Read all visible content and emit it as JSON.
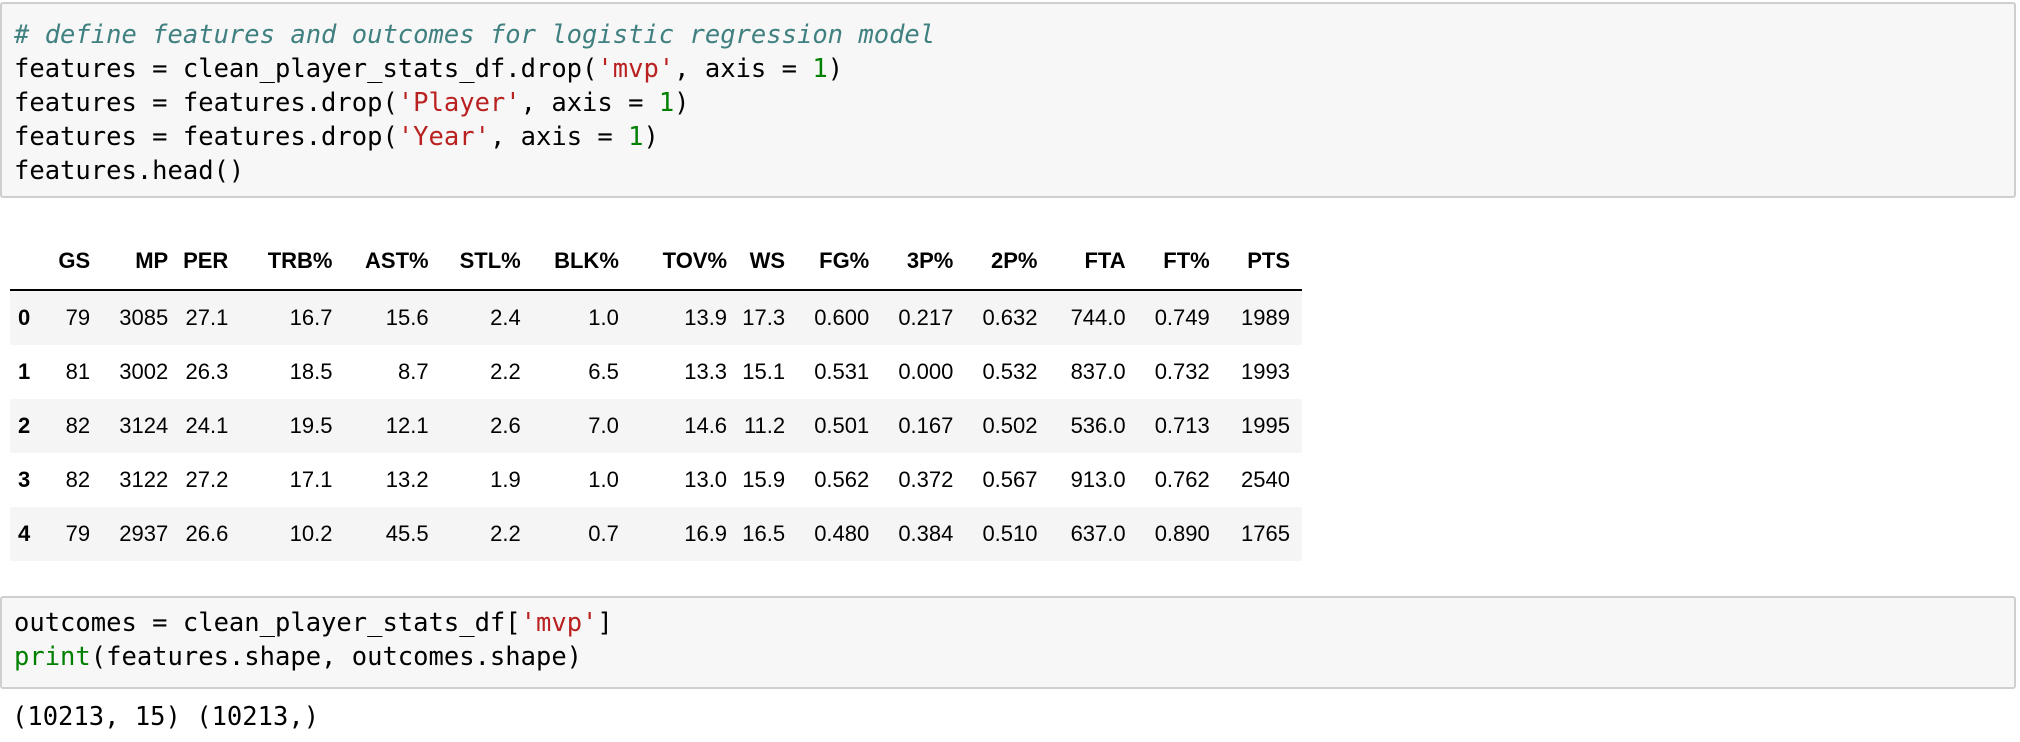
{
  "cell1": {
    "line1": {
      "comment": "# define features and outcomes for logistic regression model"
    },
    "line2": {
      "pre": "features = clean_player_stats_df.drop(",
      "str": "'mvp'",
      "mid": ", axis = ",
      "num": "1",
      "post": ")"
    },
    "line3": {
      "pre": "features = features.drop(",
      "str": "'Player'",
      "mid": ", axis = ",
      "num": "1",
      "post": ")"
    },
    "line4": {
      "pre": "features = features.drop(",
      "str": "'Year'",
      "mid": ", axis = ",
      "num": "1",
      "post": ")"
    },
    "line5": {
      "text": "features.head()"
    }
  },
  "table": {
    "columns": [
      "",
      "GS",
      "MP",
      "PER",
      "TRB%",
      "AST%",
      "STL%",
      "BLK%",
      "TOV%",
      "WS",
      "FG%",
      "3P%",
      "2P%",
      "FTA",
      "FT%",
      "PTS"
    ],
    "rows": [
      [
        "0",
        "79",
        "3085",
        "27.1",
        "16.7",
        "15.6",
        "2.4",
        "1.0",
        "13.9",
        "17.3",
        "0.600",
        "0.217",
        "0.632",
        "744.0",
        "0.749",
        "1989"
      ],
      [
        "1",
        "81",
        "3002",
        "26.3",
        "18.5",
        "8.7",
        "2.2",
        "6.5",
        "13.3",
        "15.1",
        "0.531",
        "0.000",
        "0.532",
        "837.0",
        "0.732",
        "1993"
      ],
      [
        "2",
        "82",
        "3124",
        "24.1",
        "19.5",
        "12.1",
        "2.6",
        "7.0",
        "14.6",
        "11.2",
        "0.501",
        "0.167",
        "0.502",
        "536.0",
        "0.713",
        "1995"
      ],
      [
        "3",
        "82",
        "3122",
        "27.2",
        "17.1",
        "13.2",
        "1.9",
        "1.0",
        "13.0",
        "15.9",
        "0.562",
        "0.372",
        "0.567",
        "913.0",
        "0.762",
        "2540"
      ],
      [
        "4",
        "79",
        "2937",
        "26.6",
        "10.2",
        "45.5",
        "2.2",
        "0.7",
        "16.9",
        "16.5",
        "0.480",
        "0.384",
        "0.510",
        "637.0",
        "0.890",
        "1765"
      ]
    ]
  },
  "cell2": {
    "line1": {
      "pre": "outcomes = clean_player_stats_df[",
      "str": "'mvp'",
      "post": "]"
    },
    "line2": {
      "fn": "print",
      "rest": "(features.shape, outcomes.shape)"
    }
  },
  "output2": "(10213, 15) (10213,)"
}
